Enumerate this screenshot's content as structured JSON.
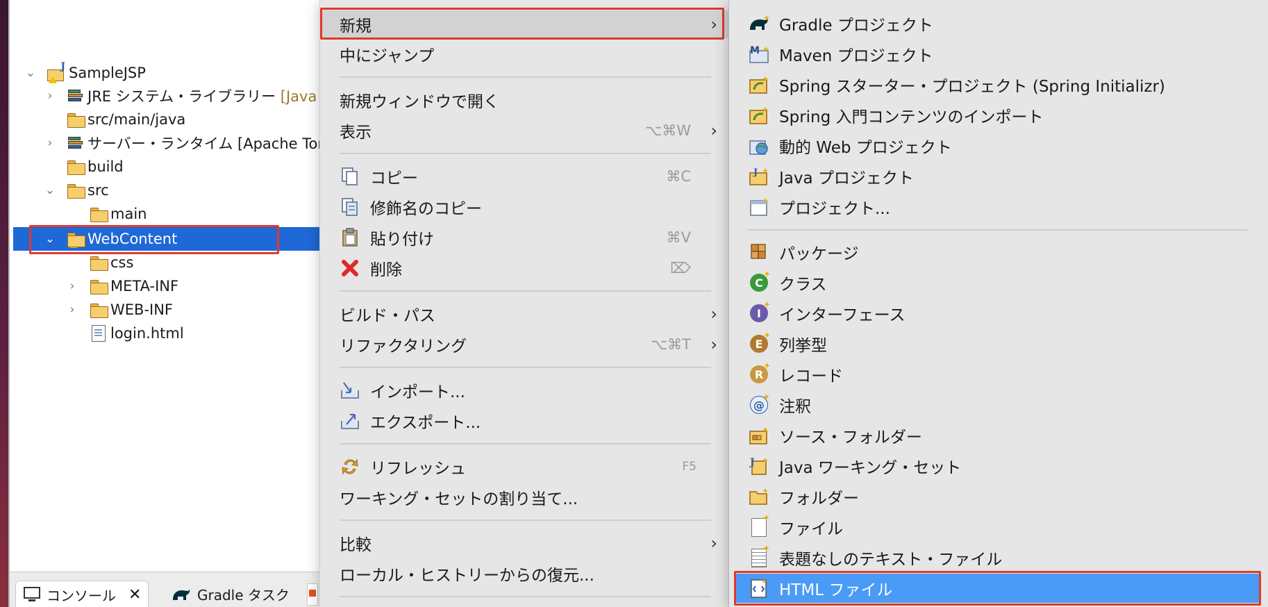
{
  "explorer": {
    "items": [
      {
        "label": "SampleJSP",
        "icon": "project-icon"
      },
      {
        "label": "JRE システム・ライブラリー",
        "suffix": "[Java",
        "icon": "library-icon"
      },
      {
        "label": "src/main/java",
        "icon": "source-folder-icon"
      },
      {
        "label": "サーバー・ランタイム [Apache Tor",
        "icon": "library-icon"
      },
      {
        "label": "build",
        "icon": "folder-icon"
      },
      {
        "label": "src",
        "icon": "folder-icon"
      },
      {
        "label": "main",
        "icon": "folder-icon"
      },
      {
        "label": "WebContent",
        "icon": "folder-icon"
      },
      {
        "label": "css",
        "icon": "folder-icon"
      },
      {
        "label": "META-INF",
        "icon": "folder-icon"
      },
      {
        "label": "WEB-INF",
        "icon": "folder-icon"
      },
      {
        "label": "login.html",
        "icon": "html-file-icon"
      }
    ]
  },
  "bottom_tabs": {
    "console": "コンソール",
    "gradle": "Gradle タスク"
  },
  "context_menu": {
    "new": {
      "label": "新規"
    },
    "go_into": {
      "label": "中にジャンプ"
    },
    "open_new_window": {
      "label": "新規ウィンドウで開く"
    },
    "show": {
      "label": "表示",
      "shortcut": "⌥⌘W"
    },
    "copy": {
      "label": "コピー",
      "shortcut": "⌘C"
    },
    "copy_qualified": {
      "label": "修飾名のコピー"
    },
    "paste": {
      "label": "貼り付け",
      "shortcut": "⌘V"
    },
    "delete": {
      "label": "削除",
      "shortcut": "⌦"
    },
    "build_path": {
      "label": "ビルド・パス"
    },
    "refactor": {
      "label": "リファクタリング",
      "shortcut": "⌥⌘T"
    },
    "import": {
      "label": "インポート..."
    },
    "export": {
      "label": "エクスポート..."
    },
    "refresh": {
      "label": "リフレッシュ",
      "shortcut": "F5"
    },
    "assign_working_sets": {
      "label": "ワーキング・セットの割り当て..."
    },
    "compare": {
      "label": "比較"
    },
    "restore_history": {
      "label": "ローカル・ヒストリーからの復元..."
    }
  },
  "submenu": {
    "items": [
      {
        "label": "Gradle プロジェクト"
      },
      {
        "label": "Maven プロジェクト"
      },
      {
        "label": "Spring スターター・プロジェクト (Spring Initializr)"
      },
      {
        "label": "Spring 入門コンテンツのインポート"
      },
      {
        "label": "動的 Web プロジェクト"
      },
      {
        "label": "Java プロジェクト"
      },
      {
        "label": "プロジェクト..."
      },
      {
        "label": "パッケージ"
      },
      {
        "label": "クラス"
      },
      {
        "label": "インターフェース"
      },
      {
        "label": "列挙型"
      },
      {
        "label": "レコード"
      },
      {
        "label": "注釈"
      },
      {
        "label": "ソース・フォルダー"
      },
      {
        "label": "Java ワーキング・セット"
      },
      {
        "label": "フォルダー"
      },
      {
        "label": "ファイル"
      },
      {
        "label": "表題なしのテキスト・ファイル"
      },
      {
        "label": "HTML ファイル"
      }
    ]
  },
  "colors": {
    "selection": "#1f68d8",
    "submenu_selection": "#4a9bf5",
    "highlight_border": "#e03a2a"
  }
}
